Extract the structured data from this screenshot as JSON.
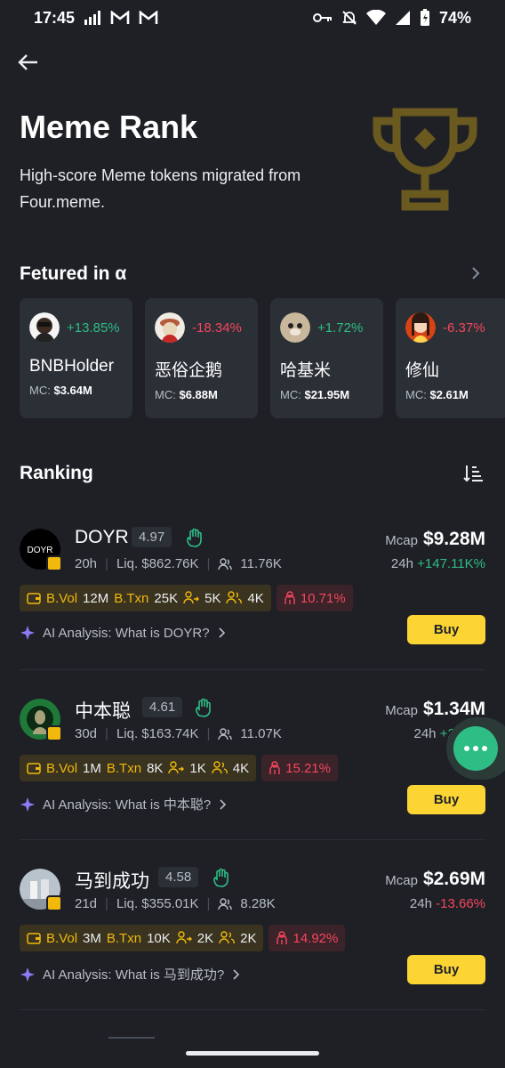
{
  "status_bar": {
    "time": "17:45",
    "battery": "74%"
  },
  "hero": {
    "title": "Meme Rank",
    "subtitle": "High-score Meme tokens migrated from Four.meme."
  },
  "featured": {
    "heading": "Fetured in α",
    "cards": [
      {
        "name": "BNBHolder",
        "change": "+13.85%",
        "trend": "up",
        "mc_label": "MC:",
        "mc": "$3.64M"
      },
      {
        "name": "恶俗企鹅",
        "change": "-18.34%",
        "trend": "down",
        "mc_label": "MC:",
        "mc": "$6.88M"
      },
      {
        "name": "哈基米",
        "change": "+1.72%",
        "trend": "up",
        "mc_label": "MC:",
        "mc": "$21.95M"
      },
      {
        "name": "修仙",
        "change": "-6.37%",
        "trend": "down",
        "mc_label": "MC:",
        "mc": "$2.61M"
      }
    ]
  },
  "ranking": {
    "heading": "Ranking",
    "mcap_label": "Mcap",
    "h24_label": "24h",
    "buy_label": "Buy",
    "items": [
      {
        "name": "DOYR",
        "avatar_text": "DOYR",
        "score": "4.97",
        "age": "20h",
        "liq": "Liq. $862.76K",
        "holders": "11.76K",
        "mcap": "$9.28M",
        "change": "+147.11K%",
        "trend": "up",
        "bvol_k": "B.Vol",
        "bvol": "12M",
        "btxn_k": "B.Txn",
        "btxn": "25K",
        "a": "5K",
        "b": "4K",
        "risk": "10.71%",
        "ai": "AI Analysis: What is DOYR?"
      },
      {
        "name": "中本聪",
        "score": "4.61",
        "age": "30d",
        "liq": "Liq. $163.74K",
        "holders": "11.07K",
        "mcap": "$1.34M",
        "change": "+2.91%",
        "trend": "up",
        "bvol_k": "B.Vol",
        "bvol": "1M",
        "btxn_k": "B.Txn",
        "btxn": "8K",
        "a": "1K",
        "b": "4K",
        "risk": "15.21%",
        "ai": "AI Analysis: What is 中本聪?"
      },
      {
        "name": "马到成功",
        "score": "4.58",
        "age": "21d",
        "liq": "Liq. $355.01K",
        "holders": "8.28K",
        "mcap": "$2.69M",
        "change": "-13.66%",
        "trend": "down",
        "bvol_k": "B.Vol",
        "bvol": "3M",
        "btxn_k": "B.Txn",
        "btxn": "10K",
        "a": "2K",
        "b": "2K",
        "risk": "14.92%",
        "ai": "AI Analysis: What is 马到成功?"
      }
    ]
  },
  "colors": {
    "accent": "#fcd535",
    "up": "#2ebd85",
    "down": "#f6465d",
    "bg": "#1e2026"
  }
}
